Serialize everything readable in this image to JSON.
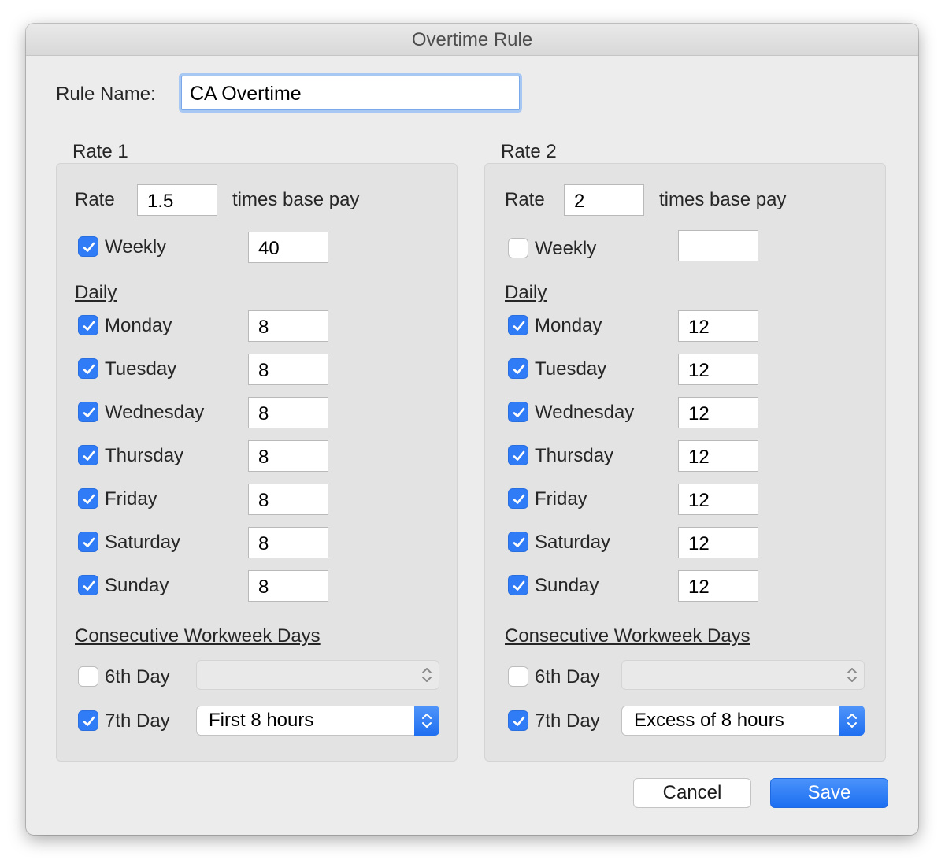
{
  "window": {
    "title": "Overtime Rule"
  },
  "rule_name": {
    "label": "Rule Name:",
    "value": "CA Overtime"
  },
  "rates": [
    {
      "heading": "Rate 1",
      "rate_label": "Rate",
      "rate_value": "1.5",
      "suffix": "times base pay",
      "weekly": {
        "label": "Weekly",
        "checked": true,
        "value": "40"
      },
      "daily_heading": "Daily",
      "days": [
        {
          "label": "Monday",
          "checked": true,
          "value": "8"
        },
        {
          "label": "Tuesday",
          "checked": true,
          "value": "8"
        },
        {
          "label": "Wednesday",
          "checked": true,
          "value": "8"
        },
        {
          "label": "Thursday",
          "checked": true,
          "value": "8"
        },
        {
          "label": "Friday",
          "checked": true,
          "value": "8"
        },
        {
          "label": "Saturday",
          "checked": true,
          "value": "8"
        },
        {
          "label": "Sunday",
          "checked": true,
          "value": "8"
        }
      ],
      "consecutive_heading": "Consecutive Workweek Days",
      "sixth_day": {
        "label": "6th Day",
        "checked": false,
        "selected": ""
      },
      "seventh_day": {
        "label": "7th Day",
        "checked": true,
        "selected": "First 8 hours"
      }
    },
    {
      "heading": "Rate 2",
      "rate_label": "Rate",
      "rate_value": "2",
      "suffix": "times base pay",
      "weekly": {
        "label": "Weekly",
        "checked": false,
        "value": ""
      },
      "daily_heading": "Daily",
      "days": [
        {
          "label": "Monday",
          "checked": true,
          "value": "12"
        },
        {
          "label": "Tuesday",
          "checked": true,
          "value": "12"
        },
        {
          "label": "Wednesday",
          "checked": true,
          "value": "12"
        },
        {
          "label": "Thursday",
          "checked": true,
          "value": "12"
        },
        {
          "label": "Friday",
          "checked": true,
          "value": "12"
        },
        {
          "label": "Saturday",
          "checked": true,
          "value": "12"
        },
        {
          "label": "Sunday",
          "checked": true,
          "value": "12"
        }
      ],
      "consecutive_heading": "Consecutive Workweek Days",
      "sixth_day": {
        "label": "6th Day",
        "checked": false,
        "selected": ""
      },
      "seventh_day": {
        "label": "7th Day",
        "checked": true,
        "selected": "Excess of 8 hours"
      }
    }
  ],
  "buttons": {
    "cancel": "Cancel",
    "save": "Save"
  },
  "colors": {
    "accent": "#2f7cf6",
    "background": "#ececec",
    "panel": "#e3e3e3"
  }
}
